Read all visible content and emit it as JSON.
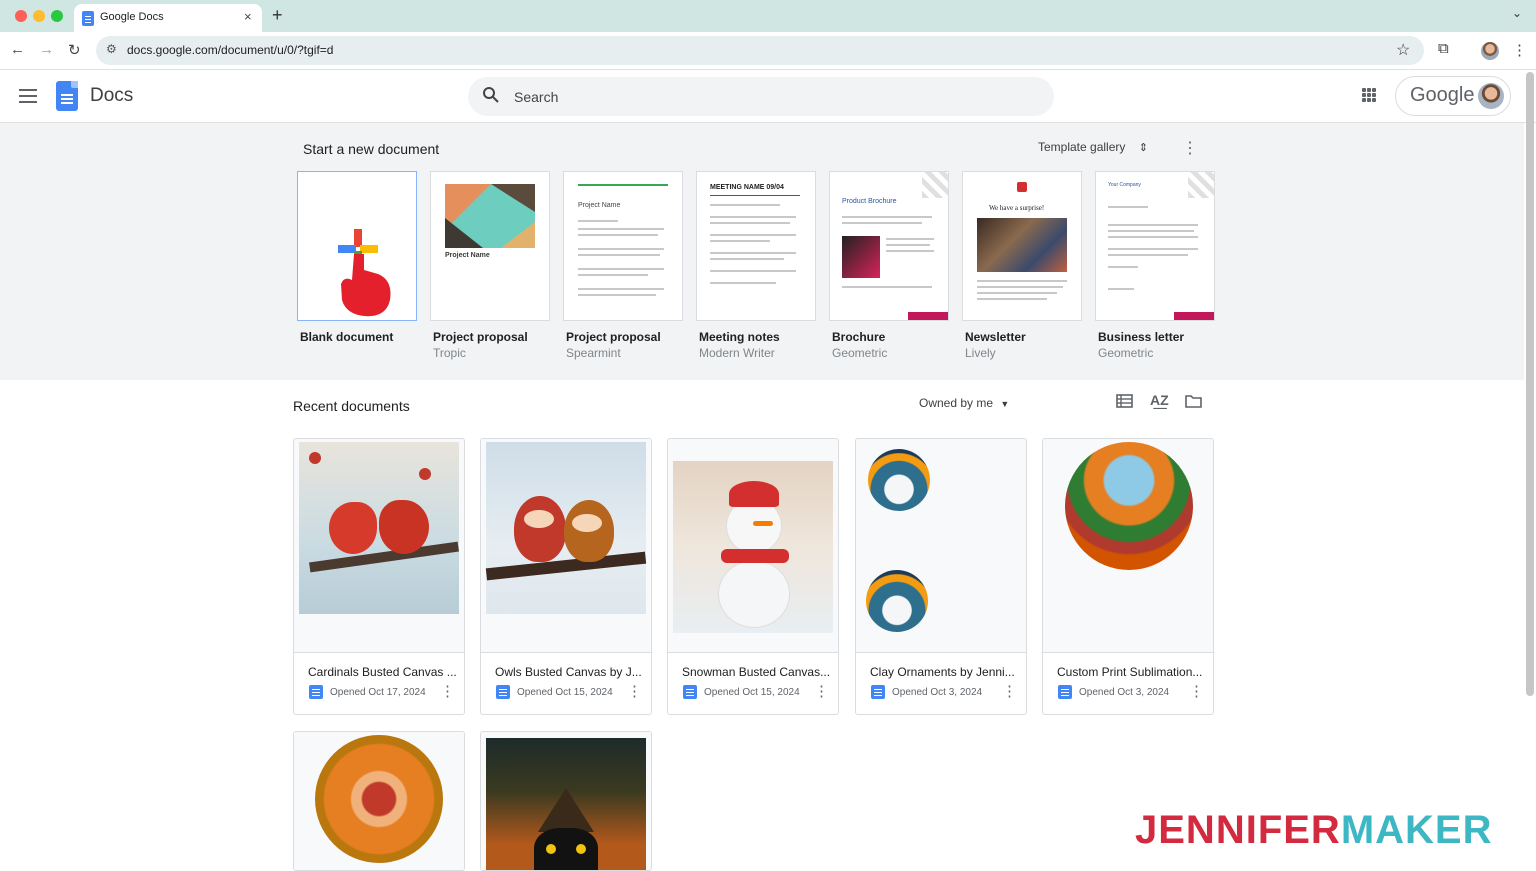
{
  "browser": {
    "tab_title": "Google Docs",
    "tab_close": "×",
    "new_tab": "+",
    "url": "docs.google.com/document/u/0/?tgif=d"
  },
  "header": {
    "app_name": "Docs",
    "search_placeholder": "Search",
    "account_brand": "Google"
  },
  "templates": {
    "title": "Start a new document",
    "gallery_label": "Template gallery",
    "items": [
      {
        "name": "Blank document",
        "sub": ""
      },
      {
        "name": "Project proposal",
        "sub": "Tropic",
        "thumb_text": "Project Name"
      },
      {
        "name": "Project proposal",
        "sub": "Spearmint",
        "thumb_text": "Project Name"
      },
      {
        "name": "Meeting notes",
        "sub": "Modern Writer",
        "thumb_text": "MEETING NAME 09/04"
      },
      {
        "name": "Brochure",
        "sub": "Geometric",
        "thumb_text": "Product Brochure"
      },
      {
        "name": "Newsletter",
        "sub": "Lively",
        "thumb_text": "We have a surprise!"
      },
      {
        "name": "Business letter",
        "sub": "Geometric",
        "thumb_text": "Your Company"
      }
    ]
  },
  "recent": {
    "title": "Recent documents",
    "owned_filter": "Owned by me",
    "docs": [
      {
        "title": "Cardinals Busted Canvas ...",
        "date": "Opened Oct 17, 2024"
      },
      {
        "title": "Owls Busted Canvas by J...",
        "date": "Opened Oct 15, 2024"
      },
      {
        "title": "Snowman Busted Canvas...",
        "date": "Opened Oct 15, 2024"
      },
      {
        "title": "Clay Ornaments by Jenni...",
        "date": "Opened Oct 3, 2024"
      },
      {
        "title": "Custom Print Sublimation...",
        "date": "Opened Oct 3, 2024"
      },
      {
        "title": "",
        "date": ""
      },
      {
        "title": "",
        "date": ""
      }
    ]
  },
  "watermark": {
    "part1": "JENNIFER",
    "part2": "MAKER"
  },
  "colors": {
    "accent": "#4285f4",
    "tab_bar": "#cfe6e3",
    "template_bg": "#f1f3f4",
    "brand_red": "#d42a3f",
    "brand_teal": "#3db7c4"
  }
}
